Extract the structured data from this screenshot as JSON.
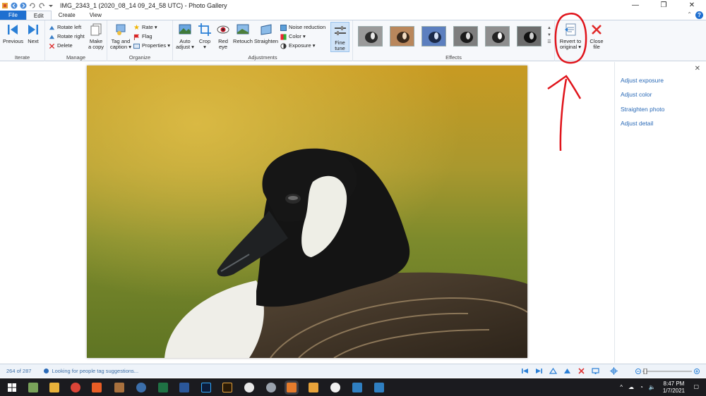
{
  "window": {
    "title": "IMG_2343_1 (2020_08_14 09_24_58 UTC) - Photo Gallery",
    "controls": [
      "minimize-icon",
      "maximize-icon",
      "close-icon"
    ]
  },
  "tabs": [
    {
      "label": "File"
    },
    {
      "label": "Edit"
    },
    {
      "label": "Create"
    },
    {
      "label": "View"
    }
  ],
  "ribbon": {
    "iterate": {
      "label": "Iterate",
      "previous": "Previous",
      "next": "Next"
    },
    "manage": {
      "label": "Manage",
      "rotate_left": "Rotate left",
      "rotate_right": "Rotate right",
      "delete": "Delete",
      "make_copy_1": "Make",
      "make_copy_2": "a copy"
    },
    "organize": {
      "label": "Organize",
      "tag_1": "Tag and",
      "tag_2": "caption ▾",
      "rate": "Rate ▾",
      "flag": "Flag",
      "properties": "Properties ▾"
    },
    "adjustments": {
      "label": "Adjustments",
      "auto_1": "Auto",
      "auto_2": "adjust ▾",
      "crop_1": "Crop",
      "crop_2": "▾",
      "redeye_1": "Red",
      "redeye_2": "eye",
      "retouch": "Retouch",
      "straighten": "Straighten",
      "noise": "Noise reduction",
      "color": "Color ▾",
      "exposure": "Exposure ▾",
      "finetune_1": "Fine",
      "finetune_2": "tune"
    },
    "effects": {
      "label": "Effects"
    },
    "revert_1": "Revert to",
    "revert_2": "original ▾",
    "close_1": "Close",
    "close_2": "file"
  },
  "side_panel": {
    "links": [
      "Adjust exposure",
      "Adjust color",
      "Straighten photo",
      "Adjust detail"
    ]
  },
  "status": {
    "count": "264 of 287",
    "message": "Looking for people tag suggestions..."
  },
  "taskbar": {
    "time": "8:47 PM",
    "date": "1/7/2021"
  },
  "colors": {
    "accent": "#1e6fd0",
    "annotation": "#e0141b",
    "taskbar": "#1b1b1f"
  }
}
